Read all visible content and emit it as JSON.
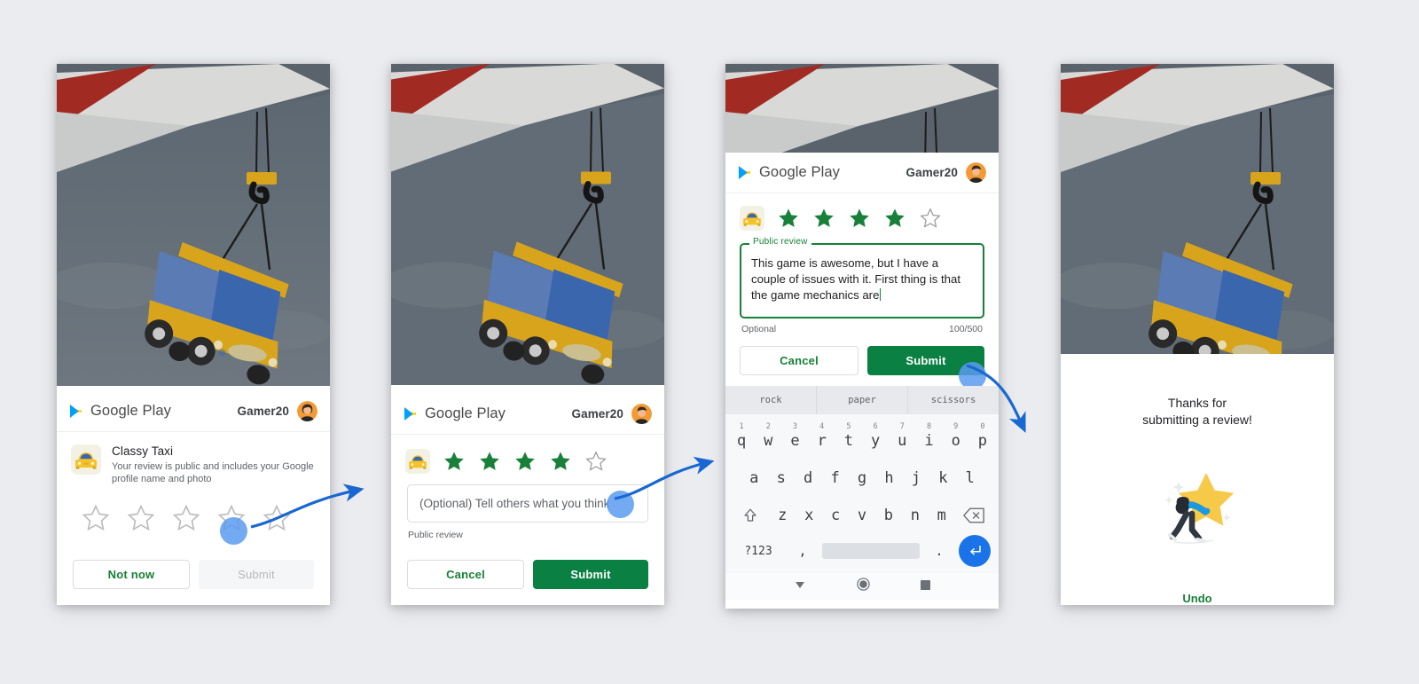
{
  "background_color": "#ebecf0",
  "accent_green": "#188038",
  "accent_blue": "#1a73e8",
  "tap_dot_color": "#5b9bf0",
  "header": {
    "brand": "Google Play",
    "user": "Gamer20",
    "logo_icon": "google-play-triangle-icon",
    "avatar_icon": "user-avatar"
  },
  "panel1": {
    "app_name": "Classy Taxi",
    "app_icon": "taxi-app-icon",
    "disclaimer": "Your review is public and includes your Google profile name and photo",
    "stars": [
      {
        "index": 1,
        "filled": false
      },
      {
        "index": 2,
        "filled": false
      },
      {
        "index": 3,
        "filled": false
      },
      {
        "index": 4,
        "filled": false
      },
      {
        "index": 5,
        "filled": false
      }
    ],
    "tap_on_star": 4,
    "buttons": {
      "secondary": "Not now",
      "primary": "Submit",
      "primary_disabled": true
    }
  },
  "panel2": {
    "app_icon": "taxi-app-icon",
    "stars": [
      {
        "index": 1,
        "filled": true
      },
      {
        "index": 2,
        "filled": true
      },
      {
        "index": 3,
        "filled": true
      },
      {
        "index": 4,
        "filled": true
      },
      {
        "index": 5,
        "filled": false
      }
    ],
    "rating": 4,
    "input_placeholder": "(Optional) Tell others what you think",
    "input_value": "",
    "helper": "Public review",
    "buttons": {
      "secondary": "Cancel",
      "primary": "Submit"
    }
  },
  "panel3": {
    "app_icon": "taxi-app-icon",
    "stars": [
      {
        "index": 1,
        "filled": true
      },
      {
        "index": 2,
        "filled": true
      },
      {
        "index": 3,
        "filled": true
      },
      {
        "index": 4,
        "filled": true
      },
      {
        "index": 5,
        "filled": false
      }
    ],
    "rating": 4,
    "field_legend": "Public review",
    "field_value": "This game is awesome, but I have a couple of issues with it. First thing is that the game mechanics are",
    "field_optional": "Optional",
    "field_counter": "100/500",
    "buttons": {
      "secondary": "Cancel",
      "primary": "Submit"
    },
    "keyboard": {
      "suggestions": [
        "rock",
        "paper",
        "scissors"
      ],
      "row1": [
        {
          "key": "q",
          "num": "1"
        },
        {
          "key": "w",
          "num": "2"
        },
        {
          "key": "e",
          "num": "3"
        },
        {
          "key": "r",
          "num": "4"
        },
        {
          "key": "t",
          "num": "5"
        },
        {
          "key": "y",
          "num": "6"
        },
        {
          "key": "u",
          "num": "7"
        },
        {
          "key": "i",
          "num": "8"
        },
        {
          "key": "o",
          "num": "9"
        },
        {
          "key": "p",
          "num": "0"
        }
      ],
      "row2": [
        "a",
        "s",
        "d",
        "f",
        "g",
        "h",
        "j",
        "k",
        "l"
      ],
      "row3": [
        "z",
        "x",
        "c",
        "v",
        "b",
        "n",
        "m"
      ],
      "shift_icon": "shift-up-arrow-icon",
      "backspace_icon": "backspace-icon",
      "symbols_key": "?123",
      "comma_key": ",",
      "space_key": "",
      "period_key": ".",
      "enter_icon": "enter-arrow-icon",
      "navbar": [
        "back-triangle-icon",
        "home-circle-icon",
        "recents-square-icon"
      ]
    }
  },
  "panel4": {
    "title_line1": "Thanks for",
    "title_line2": "submitting a review!",
    "illustration": "person-pushing-star-illustration",
    "undo_label": "Undo"
  },
  "annotations": {
    "arrow1": "arrow-panel1-to-panel2",
    "arrow2": "arrow-panel2-to-panel3",
    "arrow3": "arrow-panel3-to-panel4"
  }
}
